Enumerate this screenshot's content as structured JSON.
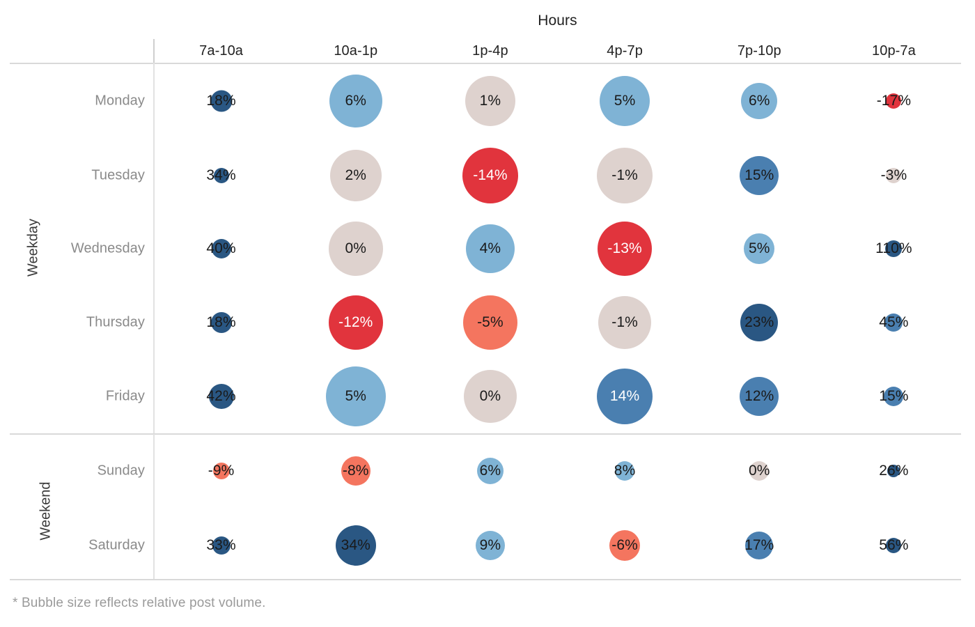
{
  "axis": {
    "x_title": "Hours",
    "y_group_labels": [
      "Weekday",
      "Weekend"
    ]
  },
  "footnote": "* Bubble size reflects relative post volume.",
  "colors": {
    "dark_blue": "#2a5783",
    "mid_blue": "#4a7fb0",
    "light_blue": "#7fb3d5",
    "neutral": "#ded2ce",
    "salmon": "#f4755f",
    "red": "#e1343d"
  },
  "chart_data": {
    "type": "heatmap",
    "title": "Hours",
    "xlabel": "Hours",
    "ylabel": "",
    "grid": true,
    "legend": null,
    "value_unit": "%",
    "size_encodes": "relative post volume",
    "categories": [
      "7a-10a",
      "10a-1p",
      "1p-4p",
      "4p-7p",
      "7p-10p",
      "10p-7a"
    ],
    "row_groups": [
      {
        "name": "Weekday",
        "rows": [
          "Monday",
          "Tuesday",
          "Wednesday",
          "Thursday",
          "Friday"
        ]
      },
      {
        "name": "Weekend",
        "rows": [
          "Sunday",
          "Saturday"
        ]
      }
    ],
    "rows": [
      {
        "label": "Monday",
        "group": "Weekday",
        "cells": [
          {
            "hour": "7a-10a",
            "label": "18%",
            "value": 18,
            "size": 31,
            "color": "#2a5783",
            "text_color": "#1a1a1a"
          },
          {
            "hour": "10a-1p",
            "label": "6%",
            "value": 6,
            "size": 76,
            "color": "#7fb3d5",
            "text_color": "#1a1a1a"
          },
          {
            "hour": "1p-4p",
            "label": "1%",
            "value": 1,
            "size": 72,
            "color": "#ded2ce",
            "text_color": "#1a1a1a"
          },
          {
            "hour": "4p-7p",
            "label": "5%",
            "value": 5,
            "size": 72,
            "color": "#7fb3d5",
            "text_color": "#1a1a1a"
          },
          {
            "hour": "7p-10p",
            "label": "6%",
            "value": 6,
            "size": 52,
            "color": "#7fb3d5",
            "text_color": "#1a1a1a"
          },
          {
            "hour": "10p-7a",
            "label": "-17%",
            "value": -17,
            "size": 22,
            "color": "#e1343d",
            "text_color": "#1a1a1a"
          }
        ]
      },
      {
        "label": "Tuesday",
        "group": "Weekday",
        "cells": [
          {
            "hour": "7a-10a",
            "label": "34%",
            "value": 34,
            "size": 22,
            "color": "#2a5783",
            "text_color": "#1a1a1a"
          },
          {
            "hour": "10a-1p",
            "label": "2%",
            "value": 2,
            "size": 74,
            "color": "#ded2ce",
            "text_color": "#1a1a1a"
          },
          {
            "hour": "1p-4p",
            "label": "-14%",
            "value": -14,
            "size": 80,
            "color": "#e1343d",
            "text_color": "#ffffff"
          },
          {
            "hour": "4p-7p",
            "label": "-1%",
            "value": -1,
            "size": 80,
            "color": "#ded2ce",
            "text_color": "#1a1a1a"
          },
          {
            "hour": "7p-10p",
            "label": "15%",
            "value": 15,
            "size": 56,
            "color": "#4a7fb0",
            "text_color": "#1a1a1a"
          },
          {
            "hour": "10p-7a",
            "label": "-3%",
            "value": -3,
            "size": 22,
            "color": "#ded2ce",
            "text_color": "#1a1a1a"
          }
        ]
      },
      {
        "label": "Wednesday",
        "group": "Weekday",
        "cells": [
          {
            "hour": "7a-10a",
            "label": "40%",
            "value": 40,
            "size": 28,
            "color": "#2a5783",
            "text_color": "#1a1a1a"
          },
          {
            "hour": "10a-1p",
            "label": "0%",
            "value": 0,
            "size": 78,
            "color": "#ded2ce",
            "text_color": "#1a1a1a"
          },
          {
            "hour": "1p-4p",
            "label": "4%",
            "value": 4,
            "size": 70,
            "color": "#7fb3d5",
            "text_color": "#1a1a1a"
          },
          {
            "hour": "4p-7p",
            "label": "-13%",
            "value": -13,
            "size": 78,
            "color": "#e1343d",
            "text_color": "#ffffff"
          },
          {
            "hour": "7p-10p",
            "label": "5%",
            "value": 5,
            "size": 44,
            "color": "#7fb3d5",
            "text_color": "#1a1a1a"
          },
          {
            "hour": "10p-7a",
            "label": "110%",
            "value": 110,
            "size": 24,
            "color": "#2a5783",
            "text_color": "#1a1a1a"
          }
        ]
      },
      {
        "label": "Thursday",
        "group": "Weekday",
        "cells": [
          {
            "hour": "7a-10a",
            "label": "18%",
            "value": 18,
            "size": 30,
            "color": "#2a5783",
            "text_color": "#1a1a1a"
          },
          {
            "hour": "10a-1p",
            "label": "-12%",
            "value": -12,
            "size": 78,
            "color": "#e1343d",
            "text_color": "#ffffff"
          },
          {
            "hour": "1p-4p",
            "label": "-5%",
            "value": -5,
            "size": 78,
            "color": "#f4755f",
            "text_color": "#1a1a1a"
          },
          {
            "hour": "4p-7p",
            "label": "-1%",
            "value": -1,
            "size": 76,
            "color": "#ded2ce",
            "text_color": "#1a1a1a"
          },
          {
            "hour": "7p-10p",
            "label": "23%",
            "value": 23,
            "size": 54,
            "color": "#2a5783",
            "text_color": "#1a1a1a"
          },
          {
            "hour": "10p-7a",
            "label": "45%",
            "value": 45,
            "size": 26,
            "color": "#4a7fb0",
            "text_color": "#1a1a1a"
          }
        ]
      },
      {
        "label": "Friday",
        "group": "Weekday",
        "cells": [
          {
            "hour": "7a-10a",
            "label": "42%",
            "value": 42,
            "size": 36,
            "color": "#2a5783",
            "text_color": "#1a1a1a"
          },
          {
            "hour": "10a-1p",
            "label": "5%",
            "value": 5,
            "size": 86,
            "color": "#7fb3d5",
            "text_color": "#1a1a1a"
          },
          {
            "hour": "1p-4p",
            "label": "0%",
            "value": 0,
            "size": 76,
            "color": "#ded2ce",
            "text_color": "#1a1a1a"
          },
          {
            "hour": "4p-7p",
            "label": "14%",
            "value": 14,
            "size": 80,
            "color": "#4a7fb0",
            "text_color": "#ffffff"
          },
          {
            "hour": "7p-10p",
            "label": "12%",
            "value": 12,
            "size": 56,
            "color": "#4a7fb0",
            "text_color": "#1a1a1a"
          },
          {
            "hour": "10p-7a",
            "label": "15%",
            "value": 15,
            "size": 28,
            "color": "#4a7fb0",
            "text_color": "#1a1a1a"
          }
        ]
      },
      {
        "label": "Sunday",
        "group": "Weekend",
        "cells": [
          {
            "hour": "7a-10a",
            "label": "-9%",
            "value": -9,
            "size": 24,
            "color": "#f4755f",
            "text_color": "#1a1a1a"
          },
          {
            "hour": "10a-1p",
            "label": "-8%",
            "value": -8,
            "size": 42,
            "color": "#f4755f",
            "text_color": "#1a1a1a"
          },
          {
            "hour": "1p-4p",
            "label": "6%",
            "value": 6,
            "size": 38,
            "color": "#7fb3d5",
            "text_color": "#1a1a1a"
          },
          {
            "hour": "4p-7p",
            "label": "8%",
            "value": 8,
            "size": 28,
            "color": "#7fb3d5",
            "text_color": "#1a1a1a"
          },
          {
            "hour": "7p-10p",
            "label": "0%",
            "value": 0,
            "size": 28,
            "color": "#ded2ce",
            "text_color": "#1a1a1a"
          },
          {
            "hour": "10p-7a",
            "label": "26%",
            "value": 26,
            "size": 18,
            "color": "#2a5783",
            "text_color": "#1a1a1a"
          }
        ]
      },
      {
        "label": "Saturday",
        "group": "Weekend",
        "cells": [
          {
            "hour": "7a-10a",
            "label": "33%",
            "value": 33,
            "size": 26,
            "color": "#2a5783",
            "text_color": "#1a1a1a"
          },
          {
            "hour": "10a-1p",
            "label": "34%",
            "value": 34,
            "size": 58,
            "color": "#2a5783",
            "text_color": "#1a1a1a"
          },
          {
            "hour": "1p-4p",
            "label": "9%",
            "value": 9,
            "size": 42,
            "color": "#7fb3d5",
            "text_color": "#1a1a1a"
          },
          {
            "hour": "4p-7p",
            "label": "-6%",
            "value": -6,
            "size": 44,
            "color": "#f4755f",
            "text_color": "#1a1a1a"
          },
          {
            "hour": "7p-10p",
            "label": "17%",
            "value": 17,
            "size": 40,
            "color": "#4a7fb0",
            "text_color": "#1a1a1a"
          },
          {
            "hour": "10p-7a",
            "label": "56%",
            "value": 56,
            "size": 22,
            "color": "#2a5783",
            "text_color": "#1a1a1a"
          }
        ]
      }
    ]
  }
}
